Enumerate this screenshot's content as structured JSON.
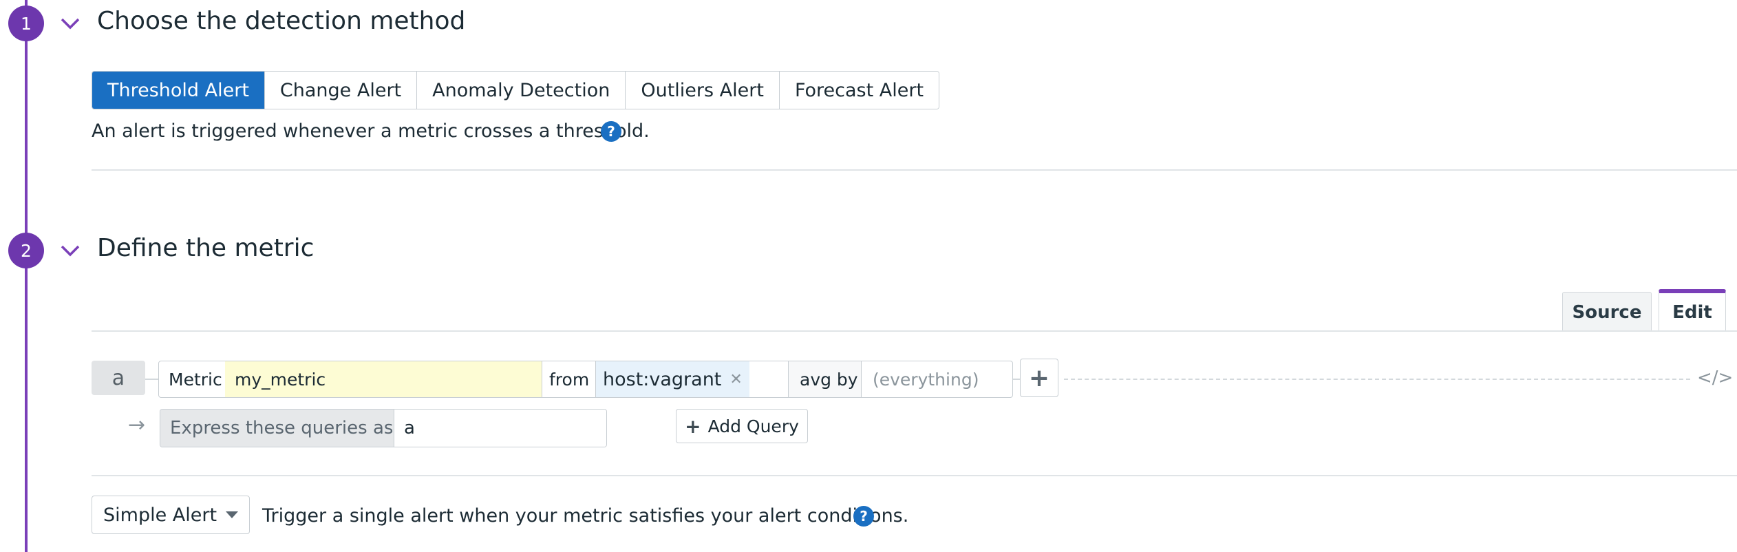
{
  "steps": [
    {
      "number": "1",
      "title": "Choose the detection method"
    },
    {
      "number": "2",
      "title": "Define the metric"
    }
  ],
  "detection": {
    "options": [
      "Threshold Alert",
      "Change Alert",
      "Anomaly Detection",
      "Outliers Alert",
      "Forecast Alert"
    ],
    "selected": "Threshold Alert",
    "description": "An alert is triggered whenever a metric crosses a threshold."
  },
  "metric_tabs": {
    "source": "Source",
    "edit": "Edit",
    "active": "Edit"
  },
  "query": {
    "letter": "a",
    "metric_label": "Metric",
    "metric_value": "my_metric",
    "from_label": "from",
    "from_tag": "host:vagrant",
    "avg_by_label": "avg by",
    "avg_by_placeholder": "(everything)",
    "express_label": "Express these queries as:",
    "express_value": "a",
    "add_query_label": "Add Query"
  },
  "alert_type": {
    "selected": "Simple Alert",
    "description": "Trigger a single alert when your metric satisfies your alert conditions."
  },
  "icons": {
    "step_toggle": "chevron-down-icon",
    "help": "question-circle-icon",
    "remove_tag": "close-icon",
    "add": "plus-icon",
    "code": "code-icon",
    "arrow": "arrow-right-icon",
    "dropdown": "caret-down-icon"
  },
  "colors": {
    "accent": "#6d37ad",
    "primary": "#1a6fc2",
    "metric_highlight": "#fdfcd4"
  }
}
